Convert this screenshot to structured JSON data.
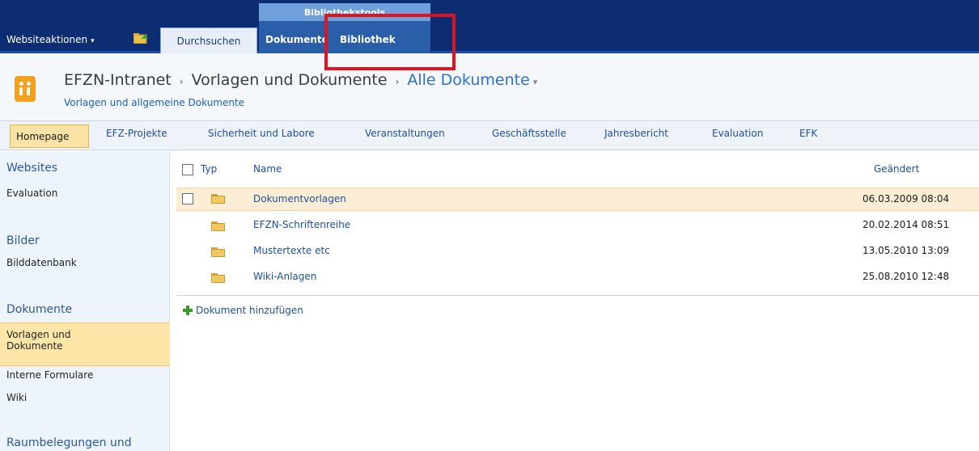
{
  "ribbon": {
    "site_actions": "Websiteaktionen",
    "site_actions_caret": "▾",
    "tab_browse": "Durchsuchen",
    "tools_header": "Bibliothekstools",
    "tab_documents": "Dokumente",
    "tab_library": "Bibliothek"
  },
  "title": {
    "crumb1": "EFZN-Intranet",
    "crumb2": "Vorlagen und Dokumente",
    "crumb3": "Alle Dokumente",
    "separator": "›",
    "dropdown": "▾",
    "subtitle": "Vorlagen und allgemeine Dokumente"
  },
  "topnav": {
    "items": [
      "Homepage",
      "EFZ-Projekte",
      "Sicherheit und Labore",
      "Veranstaltungen",
      "Geschäftsstelle",
      "Jahresbericht",
      "Evaluation",
      "EFK"
    ]
  },
  "leftnav": {
    "websites": "Websites",
    "evaluation": "Evaluation",
    "bilder": "Bilder",
    "bilddatenbank": "Bilddatenbank",
    "dokumente": "Dokumente",
    "vorlagen_line1": "Vorlagen und",
    "vorlagen_line2": "Dokumente",
    "interne": "Interne Formulare",
    "wiki": "Wiki",
    "raum": "Raumbelegungen und"
  },
  "list": {
    "col_type": "Typ",
    "col_name": "Name",
    "col_modified": "Geändert",
    "rows": [
      {
        "name": "Dokumentvorlagen",
        "modified": "06.03.2009 08:04"
      },
      {
        "name": "EFZN-Schriftenreihe",
        "modified": "20.02.2014 08:51"
      },
      {
        "name": "Mustertexte etc",
        "modified": "13.05.2010 13:09"
      },
      {
        "name": "Wiki-Anlagen",
        "modified": "25.08.2010 12:48"
      }
    ],
    "add_document": "Dokument hinzufügen"
  },
  "colors": {
    "ribbon": "#0d2d72",
    "tools_group": "#2a5ea8",
    "highlight_box": "#e0141e",
    "link": "#1f4f9a",
    "selection": "#fde6a8"
  }
}
